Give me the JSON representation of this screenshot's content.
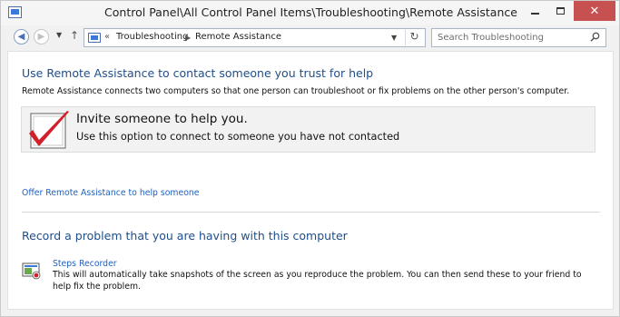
{
  "window": {
    "title": "Control Panel\\All Control Panel Items\\Troubleshooting\\Remote Assistance",
    "minimize_label": "",
    "maximize_label": "",
    "close_label": "✕"
  },
  "nav": {
    "back_icon": "back-arrow-icon",
    "forward_icon": "forward-arrow-icon",
    "chevrons": "«",
    "breadcrumbs": [
      "Troubleshooting",
      "Remote Assistance"
    ],
    "separator": "▶",
    "search_placeholder": "Search Troubleshooting"
  },
  "main": {
    "heading": "Use Remote Assistance to contact someone you trust for help",
    "description": "Remote Assistance connects two computers so that one person can troubleshoot or fix problems on the other person's computer.",
    "invite": {
      "title": "Invite someone to help you.",
      "subtitle": "Use this option to connect to someone you have not contacted"
    },
    "offer_link": "Offer Remote Assistance to help someone",
    "record_heading": "Record a problem that you are having with this computer",
    "steps": {
      "link": "Steps Recorder",
      "description": "This will automatically take snapshots of the screen as you reproduce the problem. You can then send these to your friend to help fix the problem."
    }
  },
  "colors": {
    "heading": "#1e4e8c",
    "link": "#1f5fbf",
    "close_button": "#c75050",
    "check_mark": "#d21f2a"
  }
}
